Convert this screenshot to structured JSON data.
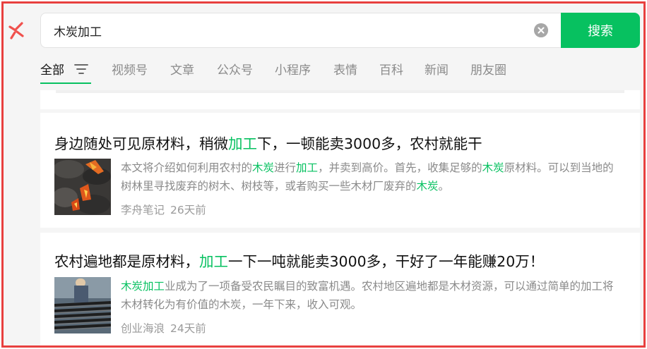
{
  "search": {
    "query": "木炭加工",
    "button_label": "搜索"
  },
  "tabs": [
    {
      "label": "全部",
      "active": true
    },
    {
      "label": "视频号"
    },
    {
      "label": "文章"
    },
    {
      "label": "公众号"
    },
    {
      "label": "小程序"
    },
    {
      "label": "表情"
    },
    {
      "label": "百科"
    },
    {
      "label": "新闻"
    },
    {
      "label": "朋友圈"
    }
  ],
  "results": [
    {
      "title": [
        "身边随处可见原材料，稍微",
        "加工",
        "下，一顿能卖3000多，农村就能干"
      ],
      "summary": [
        "本文将介绍如何利用农村的",
        "木炭",
        "进行",
        "加工",
        "，并卖到高价。首先，收集足够的",
        "木炭",
        "原材料。可以到当地的树林里寻找废弃的树木、树枝等，或者购买一些木材厂废弃的",
        "木炭",
        "。"
      ],
      "source": "李舟笔记",
      "time": "26天前"
    },
    {
      "title": [
        "农村遍地都是原材料，",
        "加工",
        "一下一吨就能卖3000多，干好了一年能赚20万！"
      ],
      "summary": [
        "木炭加工",
        "业成为了一项备受农民瞩目的致富机遇。农村地区遍地都是木材资源，可以通过简单的加工将木材转化为有价值的木炭，一年下来，收入可观。"
      ],
      "source": "创业海浪",
      "time": "24天前"
    }
  ],
  "colors": {
    "accent": "#07c160",
    "frame": "#e8403f",
    "background": "#f5f5f5"
  }
}
